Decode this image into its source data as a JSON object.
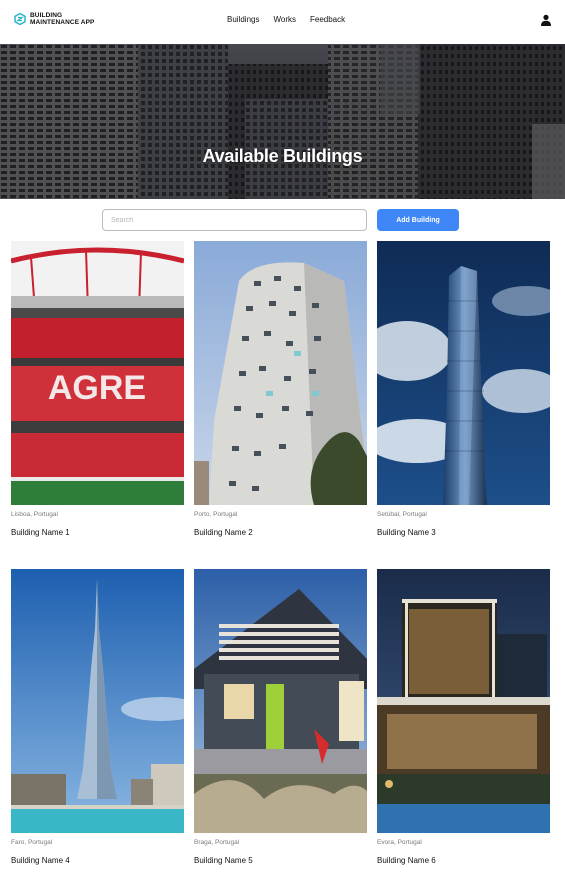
{
  "brand": {
    "line1": "BUILDING",
    "line2": "MAINTENANCE APP"
  },
  "nav": {
    "buildings": "Buildings",
    "works": "Works",
    "feedback": "Feedback"
  },
  "hero": {
    "title": "Available Buildings"
  },
  "search": {
    "placeholder": "Search",
    "value": ""
  },
  "actions": {
    "add_building": "Add Building"
  },
  "colors": {
    "accent": "#3f86f6",
    "brand_icon": "#2ab6c8"
  },
  "buildings": [
    {
      "location": "Lisboa, Portugal",
      "name": "Building Name 1",
      "image": "stadium"
    },
    {
      "location": "Porto, Portugal",
      "name": "Building Name 2",
      "image": "white-tower"
    },
    {
      "location": "Setúbal, Portugal",
      "name": "Building Name 3",
      "image": "twisted-glass-tower"
    },
    {
      "location": "Faro, Portugal",
      "name": "Building Name 4",
      "image": "spire-skyscraper"
    },
    {
      "location": "Braga, Portugal",
      "name": "Building Name 5",
      "image": "modern-house"
    },
    {
      "location": "Evora, Portugal",
      "name": "Building Name 6",
      "image": "night-villa"
    }
  ]
}
